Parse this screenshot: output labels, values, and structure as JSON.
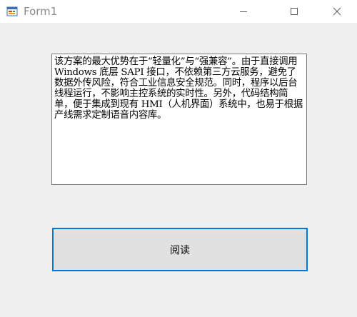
{
  "window": {
    "title": "Form1"
  },
  "titlebar": {
    "app_icon": "winforms-app-icon",
    "minimize_icon": "minimize-icon",
    "maximize_icon": "maximize-icon",
    "close_icon": "close-icon"
  },
  "textbox": {
    "value": "该方案的最大优势在于“轻量化”与“强兼容”。由于直接调用 Windows 底层 SAPI 接口，不依赖第三方云服务，避免了数据外传风险，符合工业信息安全规范。同时，程序以后台线程运行，不影响主控系统的实时性。另外，代码结构简单，便于集成到现有 HMI（人机界面）系统中，也易于根据产线需求定制语音内容库。"
  },
  "button": {
    "label": "阅读"
  },
  "colors": {
    "accent": "#0078d7",
    "window_bg": "#f0f0f0",
    "titlebar_bg": "#ffffff",
    "button_bg": "#e1e1e1"
  }
}
